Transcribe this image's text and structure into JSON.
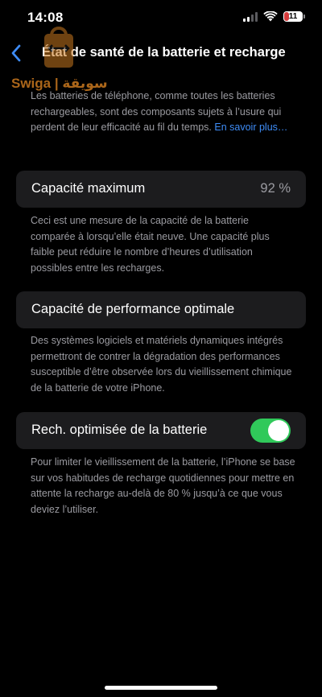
{
  "status_bar": {
    "time": "14:08",
    "battery_level": "11",
    "battery_color": "#d63b3b"
  },
  "nav": {
    "back_icon": "chevron-left-icon",
    "title": "État de santé de la batterie et recharge"
  },
  "watermark": {
    "text": "Swiga | سويقة"
  },
  "intro": {
    "text": "Les batteries de téléphone, comme toutes les batteries rechargeables, sont des composants sujets à l’usure qui perdent de leur efficacité au fil du temps. ",
    "link": "En savoir plus…"
  },
  "max_capacity": {
    "label": "Capacité maximum",
    "value": "92 %",
    "description": "Ceci est une mesure de la capacité de la batterie comparée à lorsqu’elle était neuve. Une capacité plus faible peut réduire le nombre d’heures d’utilisation possibles entre les recharges."
  },
  "peak_performance": {
    "label": "Capacité de performance optimale",
    "description": "Des systèmes logiciels et matériels dynamiques intégrés permettront de contrer la dégradation des performances susceptible d’être observée lors du vieillissement chimique de la batterie de votre iPhone."
  },
  "optimized_charging": {
    "label": "Rech. optimisée de la batterie",
    "enabled": true,
    "toggle_color": "#30c95a",
    "description": "Pour limiter le vieillissement de la batterie, l’iPhone se base sur vos habitudes de recharge quotidiennes pour mettre en attente la recharge au-delà de 80 % jusqu’à ce que vous deviez l’utiliser."
  },
  "colors": {
    "background": "#000000",
    "cell_background": "#1c1c1e",
    "secondary_text": "#9b9ba1",
    "link": "#3e8cf6"
  }
}
